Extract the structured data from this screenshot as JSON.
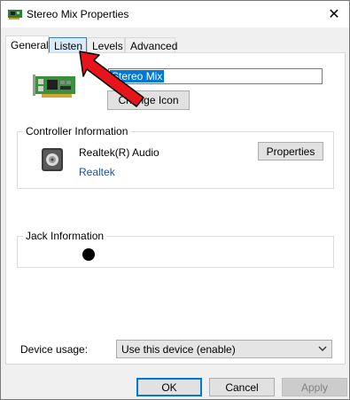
{
  "window": {
    "title": "Stereo Mix Properties"
  },
  "tabs": [
    {
      "label": "General",
      "active": true
    },
    {
      "label": "Listen",
      "active": false
    },
    {
      "label": "Levels",
      "active": false
    },
    {
      "label": "Advanced",
      "active": false
    }
  ],
  "general": {
    "device_name": "Stereo Mix",
    "change_icon_label": "Change Icon",
    "controller_group_label": "Controller Information",
    "controller_name": "Realtek(R) Audio",
    "controller_vendor": "Realtek",
    "properties_label": "Properties",
    "jack_group_label": "Jack Information",
    "device_usage_label": "Device usage:",
    "device_usage_value": "Use this device (enable)"
  },
  "buttons": {
    "ok": "OK",
    "cancel": "Cancel",
    "apply": "Apply"
  },
  "icons": {
    "device": "sound-card-icon",
    "controller": "speaker-icon",
    "close": "close-icon",
    "dropdown": "chevron-down-icon",
    "annotation": "red-arrow-icon"
  },
  "colors": {
    "accent": "#0078d7",
    "arrow": "#e8141c",
    "link": "#1e4e9c"
  }
}
